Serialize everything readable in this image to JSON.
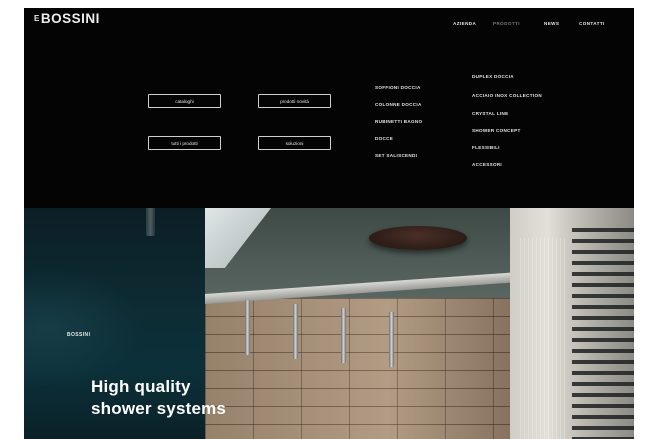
{
  "brand": {
    "prefix": "E",
    "name": "BOSSINI"
  },
  "nav": {
    "items": [
      {
        "label": "AZIENDA",
        "active": false
      },
      {
        "label": "PRODOTTI",
        "active": true
      },
      {
        "label": "NEWS",
        "active": false
      },
      {
        "label": "CONTATTI",
        "active": false
      }
    ]
  },
  "menu": {
    "buttons": [
      "cataloghi",
      "prodotti novità",
      "tutti i prodotti",
      "soluzioni"
    ],
    "col1": [
      "SOFFIONI DOCCIA",
      "COLONNE DOCCIA",
      "RUBINETTI BAGNO",
      "DOCCE",
      "SET SALISCENDI"
    ],
    "col2": [
      "DUPLEX DOCCIA",
      "ACCIAIO INOX COLLECTION",
      "CRYSTAL LINE",
      "SHOWER CONCEPT",
      "FLESSIBILI",
      "ACCESSORI"
    ]
  },
  "hero": {
    "brand_label": "BOSSINI",
    "title_line1": "High quality",
    "title_line2": "shower systems"
  },
  "colors": {
    "header_bg": "#040404",
    "text_light": "#e6e6e6",
    "nav_active": "#7a7a7a",
    "hero_dark": "#0c2b33"
  }
}
